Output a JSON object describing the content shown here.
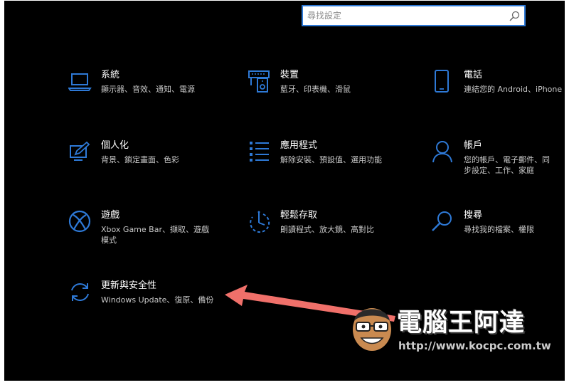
{
  "search": {
    "placeholder": "尋找設定"
  },
  "tiles": [
    {
      "title": "系統",
      "desc": "顯示器、音效、通知、電源",
      "icon": "laptop-icon"
    },
    {
      "title": "裝置",
      "desc": "藍牙、印表機、滑鼠",
      "icon": "devices-icon"
    },
    {
      "title": "電話",
      "desc": "連結您的 Android、iPhone",
      "icon": "phone-icon"
    },
    {
      "title": "個人化",
      "desc": "背景、鎖定畫面、色彩",
      "icon": "personalization-icon"
    },
    {
      "title": "應用程式",
      "desc": "解除安裝、預設值、選用功能",
      "icon": "apps-list-icon"
    },
    {
      "title": "帳戶",
      "desc": "您的帳戶、電子郵件、同步設定、工作、家庭",
      "icon": "person-icon"
    },
    {
      "title": "遊戲",
      "desc": "Xbox Game Bar、擷取、遊戲模式",
      "icon": "xbox-icon"
    },
    {
      "title": "輕鬆存取",
      "desc": "朗讀程式、放大鏡、高對比",
      "icon": "ease-of-access-icon"
    },
    {
      "title": "搜尋",
      "desc": "尋找我的檔案、權限",
      "icon": "magnifier-icon"
    },
    {
      "title": "更新與安全性",
      "desc": "Windows Update、復原、備份",
      "icon": "sync-arrows-icon"
    }
  ],
  "watermark": {
    "text": "電腦王阿達",
    "url": "http://www.kocpc.com.tw"
  },
  "colors": {
    "accent": "#2e79d6",
    "background": "#000000",
    "arrow": "#f0706a"
  }
}
